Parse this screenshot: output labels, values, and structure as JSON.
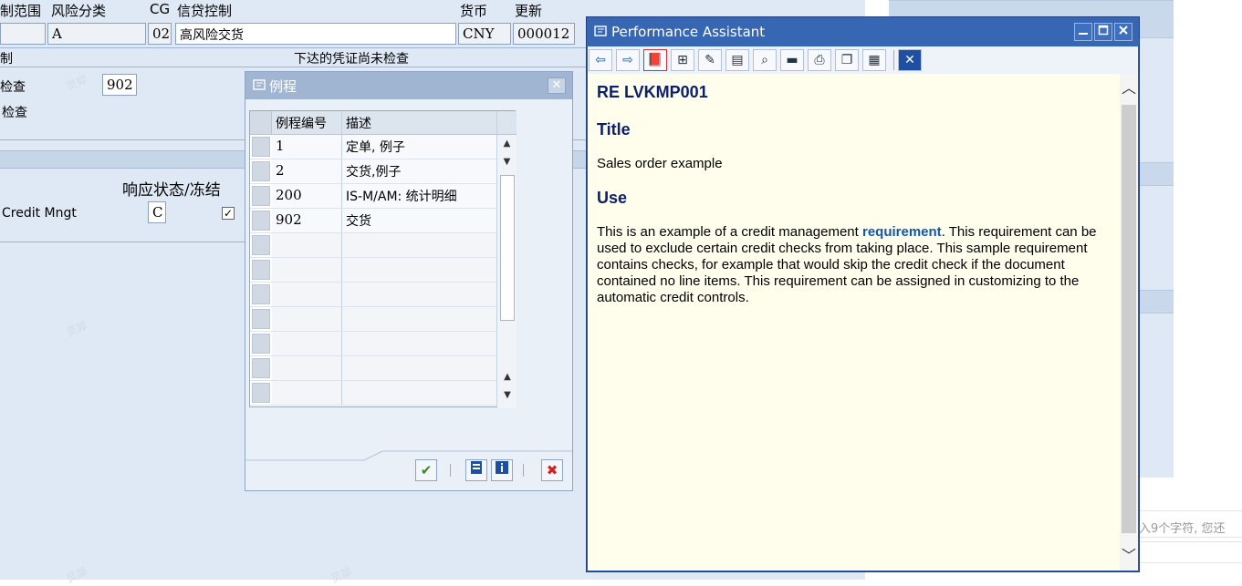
{
  "header": {
    "labels": [
      "制范围",
      "风险分类",
      "CG",
      "信贷控制",
      "货币",
      "更新"
    ],
    "risk_class": "A",
    "cg_value": "02",
    "credit_control": "高风险交货",
    "currency": "CNY",
    "update": "000012"
  },
  "section": {
    "left_label": "制",
    "right_label": "下达的凭证尚未检查",
    "check_label": "检查",
    "check_value": "902",
    "check2_label": "检查",
    "response_label": "响应状态/冻结",
    "credit_mngt_label": "Credit Mngt",
    "credit_mngt_value": "C",
    "checkbox_mark": "✓"
  },
  "dialog": {
    "title": "例程",
    "col_number": "例程编号",
    "col_desc": "描述",
    "rows": [
      {
        "number": "1",
        "desc": "定单, 例子"
      },
      {
        "number": "2",
        "desc": "交货,例子"
      },
      {
        "number": "200",
        "desc": "IS-M/AM: 统计明细"
      },
      {
        "number": "902",
        "desc": "交货"
      }
    ],
    "close_glyph": "✕",
    "ok_glyph": "✔",
    "cancel_glyph": "✖"
  },
  "pa": {
    "title": "Performance Assistant",
    "heading": "RE LVKMP001",
    "section_title": "Title",
    "title_text": "Sales order example",
    "section_use": "Use",
    "use_text_1": "This is an example of a credit management ",
    "use_link": "requirement",
    "use_text_2": ".  This requirement can be used to exclude certain credit checks from taking place.  This sample requirement contains checks, for example that would skip the credit check if the document contained no line items.  This requirement can be assigned in customizing to the automatic credit controls."
  },
  "right_hint": "输入9个字符, 您还",
  "watermark": "灵犀",
  "colors": {
    "pa_titlebar": "#3766b3",
    "pa_content_bg": "#fffdeb",
    "heading_color": "#0b1f6a",
    "link_color": "#1556a8",
    "sap_bg": "#dfe9f5"
  }
}
